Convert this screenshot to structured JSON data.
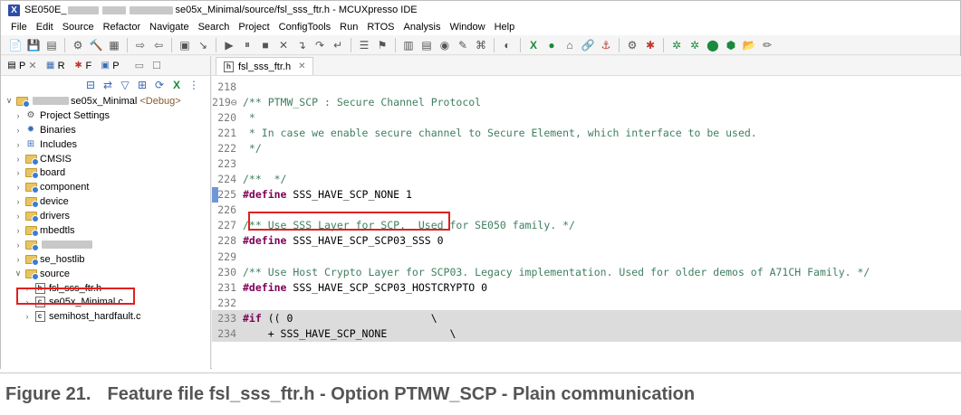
{
  "window": {
    "title_prefix": "SE050E_",
    "title_suffix": "se05x_Minimal/source/fsl_sss_ftr.h - MCUXpresso IDE"
  },
  "menu": [
    "File",
    "Edit",
    "Source",
    "Refactor",
    "Navigate",
    "Search",
    "Project",
    "ConfigTools",
    "Run",
    "RTOS",
    "Analysis",
    "Window",
    "Help"
  ],
  "left_panel": {
    "tabs": [
      "P",
      "R",
      "F",
      "P"
    ],
    "project": {
      "name_suffix": "se05x_Minimal",
      "config": "<Debug>"
    },
    "items": [
      {
        "label": "Project Settings",
        "type": "settings"
      },
      {
        "label": "Binaries",
        "type": "binaries"
      },
      {
        "label": "Includes",
        "type": "includes"
      },
      {
        "label": "CMSIS",
        "type": "folder"
      },
      {
        "label": "board",
        "type": "folder"
      },
      {
        "label": "component",
        "type": "folder"
      },
      {
        "label": "device",
        "type": "folder"
      },
      {
        "label": "drivers",
        "type": "folder"
      },
      {
        "label": "mbedtls",
        "type": "folder"
      },
      {
        "label": "",
        "type": "folder"
      },
      {
        "label": "se_hostlib",
        "type": "folder"
      },
      {
        "label": "source",
        "type": "folder"
      }
    ],
    "files": [
      {
        "label": "fsl_sss_ftr.h",
        "kind": "h"
      },
      {
        "label": "se05x_Minimal.c",
        "kind": "c"
      },
      {
        "label": "semihost_hardfault.c",
        "kind": "c"
      }
    ]
  },
  "editor": {
    "tab_label": "fsl_sss_ftr.h",
    "lines": [
      {
        "n": "218",
        "text": ""
      },
      {
        "n": "219⊖",
        "text": "/** PTMW_SCP : Secure Channel Protocol",
        "cls": "cm"
      },
      {
        "n": "220",
        "text": " *",
        "cls": "cm"
      },
      {
        "n": "221",
        "text": " * In case we enable secure channel to Secure Element, which interface to be used.",
        "cls": "cm"
      },
      {
        "n": "222",
        "text": " */",
        "cls": "cm"
      },
      {
        "n": "223",
        "text": ""
      },
      {
        "n": "224",
        "text": "/**  */",
        "cls": "cm"
      },
      {
        "n": "225",
        "kw": "#define",
        "rest": " SSS_HAVE_SCP_NONE 1"
      },
      {
        "n": "226",
        "text": ""
      },
      {
        "n": "227",
        "text": "/** Use SSS Layer for SCP.  Used for SE050 family. */",
        "cls": "cm"
      },
      {
        "n": "228",
        "kw": "#define",
        "rest": " SSS_HAVE_SCP_SCP03_SSS 0"
      },
      {
        "n": "229",
        "text": ""
      },
      {
        "n": "230",
        "text": "/** Use Host Crypto Layer for SCP03. Legacy implementation. Used for older demos of A71CH Family. */",
        "cls": "cm"
      },
      {
        "n": "231",
        "kw": "#define",
        "rest": " SSS_HAVE_SCP_SCP03_HOSTCRYPTO 0"
      },
      {
        "n": "232",
        "text": ""
      },
      {
        "n": "233",
        "kw": "#if",
        "rest": " (( 0                      \\",
        "gray": true
      },
      {
        "n": "234",
        "text": "    + SSS_HAVE_SCP_NONE          \\",
        "gray": true
      }
    ]
  },
  "caption": {
    "number": "Figure 21.",
    "text": "Feature file fsl_sss_ftr.h - Option PTMW_SCP - Plain communication"
  }
}
